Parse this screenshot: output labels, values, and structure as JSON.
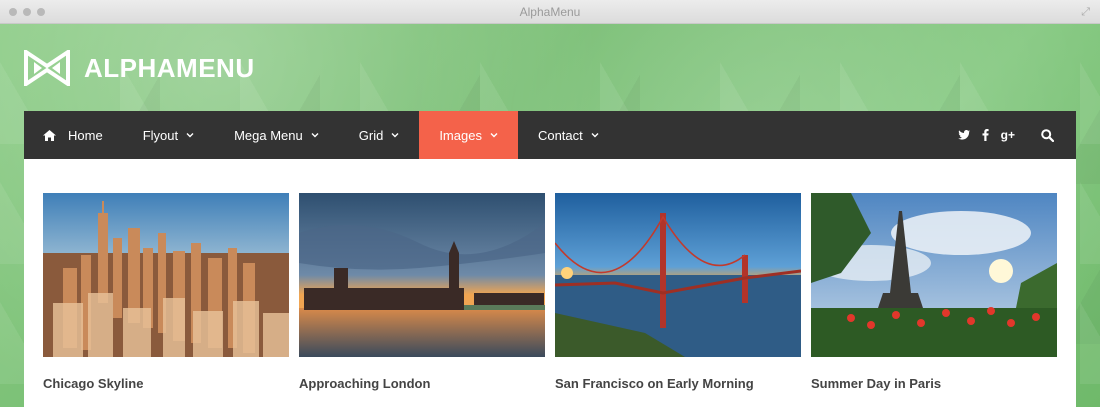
{
  "window": {
    "title": "AlphaMenu"
  },
  "brand": {
    "name": "ALPHAMENU"
  },
  "nav": {
    "items": [
      {
        "label": "Home",
        "icon": "home-icon"
      },
      {
        "label": "Flyout",
        "icon": "chevron-down-icon"
      },
      {
        "label": "Mega Menu",
        "icon": "chevron-down-icon"
      },
      {
        "label": "Grid",
        "icon": "chevron-down-icon"
      },
      {
        "label": "Images",
        "icon": "chevron-down-icon",
        "active": true
      },
      {
        "label": "Contact",
        "icon": "chevron-down-icon"
      }
    ],
    "social": {
      "twitter": "twitter-icon",
      "facebook": "facebook-icon",
      "google_plus": "g+"
    },
    "search_icon": "search-icon"
  },
  "colors": {
    "nav_bg": "#333333",
    "active": "#f4624a",
    "panel": "#ffffff",
    "bg": "#7fc27a"
  },
  "gallery": [
    {
      "title": "Chicago Skyline"
    },
    {
      "title": "Approaching London"
    },
    {
      "title": "San Francisco on Early Morning"
    },
    {
      "title": "Summer Day in Paris"
    }
  ]
}
